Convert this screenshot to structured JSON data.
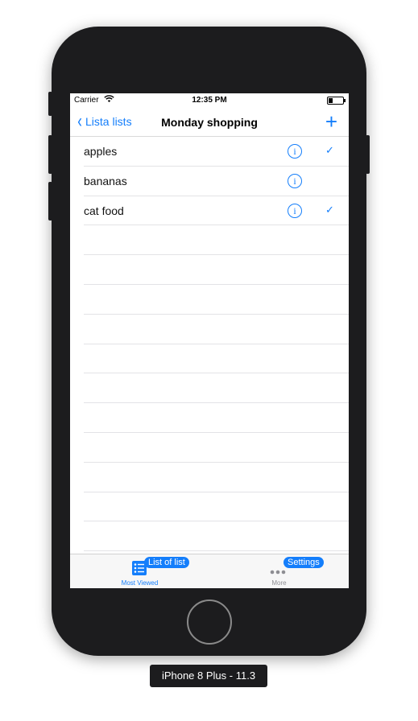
{
  "status_bar": {
    "carrier": "Carrier",
    "time": "12:35 PM"
  },
  "nav": {
    "back_label": "Lista lists",
    "title": "Monday shopping",
    "add_symbol": "+"
  },
  "items": [
    {
      "label": "apples",
      "checked": true
    },
    {
      "label": "bananas",
      "checked": false
    },
    {
      "label": "cat food",
      "checked": true
    }
  ],
  "info_symbol": "i",
  "check_symbol": "✓",
  "tabbar": {
    "tabs": [
      {
        "label": "Most Viewed",
        "badge": "List of list",
        "active": true
      },
      {
        "label": "More",
        "badge": "Settings",
        "active": false
      }
    ]
  },
  "device": {
    "label": "iPhone 8 Plus - 11.3"
  },
  "colors": {
    "accent": "#147efb",
    "inactive": "#8e8e93"
  }
}
